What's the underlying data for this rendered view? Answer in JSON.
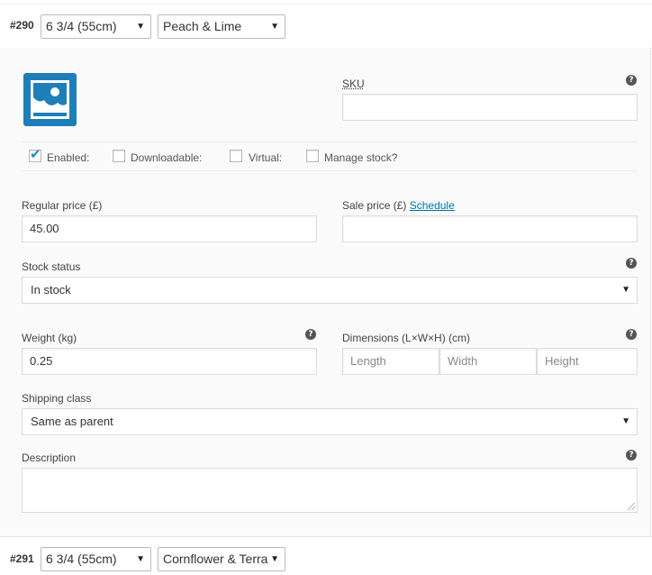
{
  "variations": [
    {
      "id": "#290",
      "size": "6 3/4 (55cm)",
      "color": "Peach & Lime"
    },
    {
      "id": "#291",
      "size": "6 3/4 (55cm)",
      "color": "Cornflower & Terra"
    }
  ],
  "image_icon": "image-placeholder-icon",
  "sku": {
    "label": "SKU",
    "value": ""
  },
  "options": {
    "enabled": {
      "label": "Enabled:",
      "checked": true
    },
    "downloadable": {
      "label": "Downloadable:",
      "checked": false
    },
    "virtual": {
      "label": "Virtual:",
      "checked": false
    },
    "manage_stock": {
      "label": "Manage stock?",
      "checked": false
    }
  },
  "pricing": {
    "regular_label": "Regular price (£)",
    "regular_value": "45.00",
    "sale_label": "Sale price (£)",
    "schedule_link": "Schedule",
    "sale_value": ""
  },
  "stock": {
    "label": "Stock status",
    "value": "In stock"
  },
  "weight": {
    "label": "Weight (kg)",
    "value": "0.25"
  },
  "dimensions": {
    "label": "Dimensions (L×W×H) (cm)",
    "length_placeholder": "Length",
    "width_placeholder": "Width",
    "height_placeholder": "Height"
  },
  "shipping": {
    "label": "Shipping class",
    "value": "Same as parent"
  },
  "description": {
    "label": "Description",
    "value": ""
  },
  "help_glyph": "?",
  "colors": {
    "accent": "#0073aa",
    "icon_blue": "#1e7fb8"
  }
}
